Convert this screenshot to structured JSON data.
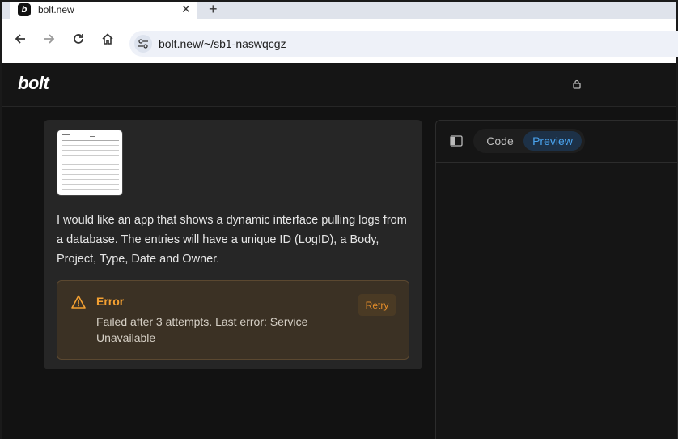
{
  "browser": {
    "tab_title": "bolt.new",
    "tab_favicon_letter": "b",
    "close_glyph": "✕",
    "new_tab_glyph": "+",
    "url": "bolt.new/~/sb1-naswqcgz"
  },
  "app": {
    "logo": "bolt",
    "lock_icon": "lock-icon"
  },
  "chat": {
    "message": "I would like an app that shows a dynamic interface pulling logs from a database.  The entries will have a unique ID (LogID), a Body, Project, Type, Date and Owner.",
    "error": {
      "title": "Error",
      "message": "Failed after 3 attempts. Last error: Service Unavailable",
      "retry_label": "Retry",
      "accent": "#f5a132"
    }
  },
  "workbench": {
    "tabs": [
      {
        "label": "Code",
        "active": false
      },
      {
        "label": "Preview",
        "active": true
      }
    ]
  }
}
